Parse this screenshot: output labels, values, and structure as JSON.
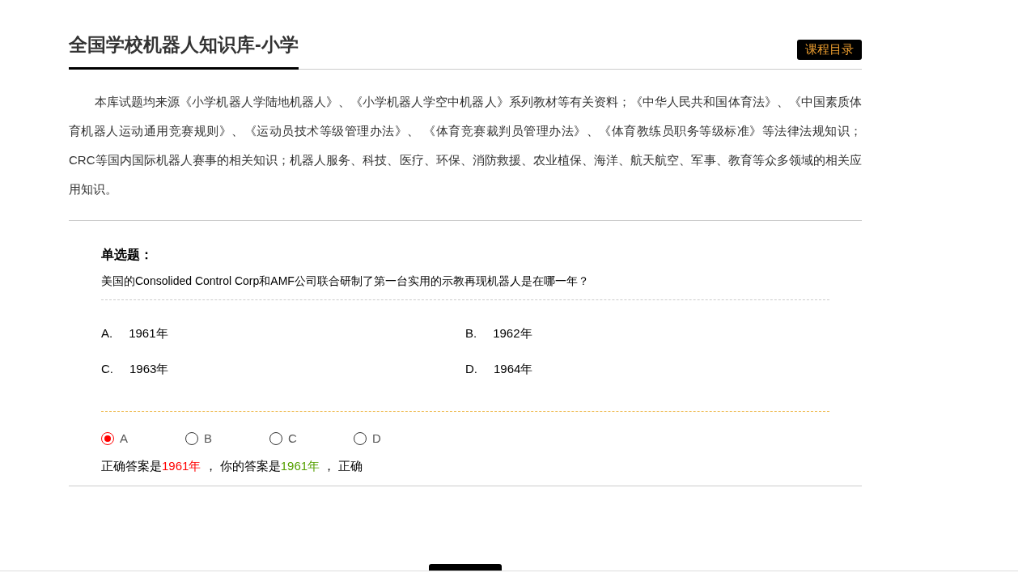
{
  "header": {
    "title": "全国学校机器人知识库-小学",
    "catalog_button": "课程目录"
  },
  "intro": "本库试题均来源《小学机器人学陆地机器人》、《小学机器人学空中机器人》系列教材等有关资料；《中华人民共和国体育法》、《中国素质体育机器人运动通用竞赛规则》、《运动员技术等级管理办法》、 《体育竞赛裁判员管理办法》、《体育教练员职务等级标准》等法律法规知识； CRC等国内国际机器人赛事的相关知识；机器人服务、科技、医疗、环保、消防救援、农业植保、海洋、航天航空、军事、教育等众多领域的相关应用知识。",
  "question": {
    "type_label": "单选题：",
    "text": "美国的Consolided Control Corp和AMF公司联合研制了第一台实用的示教再现机器人是在哪一年？",
    "options": [
      {
        "letter": "A.",
        "text": "1961年"
      },
      {
        "letter": "B.",
        "text": "1962年"
      },
      {
        "letter": "C.",
        "text": "1963年"
      },
      {
        "letter": "D.",
        "text": "1964年"
      }
    ],
    "answers": [
      {
        "label": "A",
        "selected": true
      },
      {
        "label": "B",
        "selected": false
      },
      {
        "label": "C",
        "selected": false
      },
      {
        "label": "D",
        "selected": false
      }
    ],
    "result": {
      "prefix": "正确答案是",
      "correct": "1961年",
      "middle": " ， 你的答案是",
      "yours": "1961年",
      "suffix": " ， 正确"
    }
  }
}
